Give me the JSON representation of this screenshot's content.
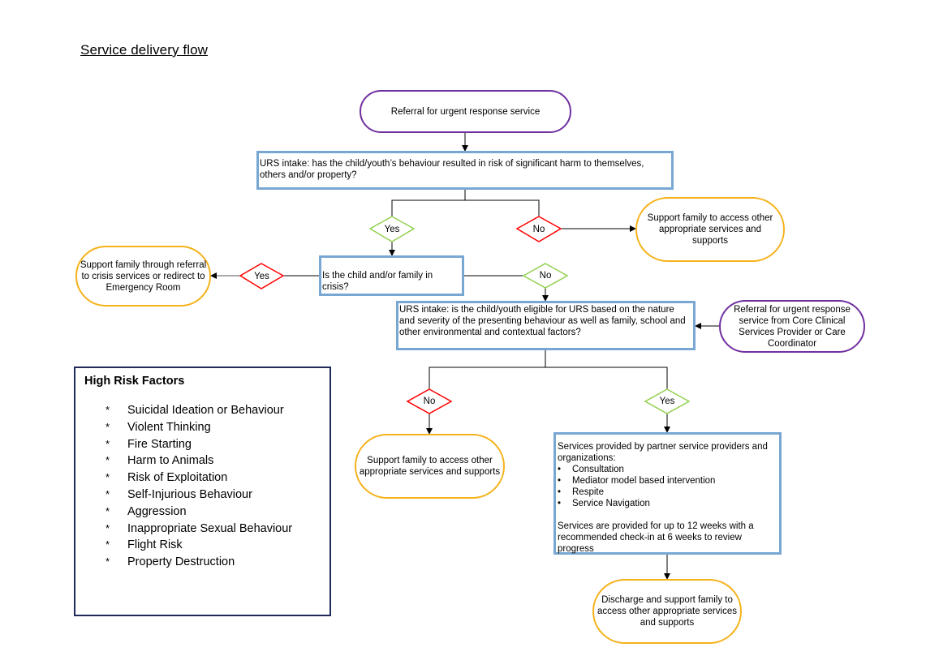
{
  "title": "Service delivery flow",
  "nodes": {
    "referral_start": "Referral for urgent response service",
    "intake_harm": "URS intake: has the child/youth’s behaviour resulted in risk of significant harm to themselves, others and/or property?",
    "support_other_top": "Support family to access other appropriate services and supports",
    "crisis_question": "Is the child and/or family in crisis?",
    "support_crisis": "Support family through referral to crisis services or redirect to Emergency Room",
    "intake_eligible": "URS intake: is the child/youth eligible for URS based on the nature and severity of the presenting behaviour as well as family, school and other environmental and contextual factors?",
    "referral_core": "Referral for urgent response service from Core Clinical Services Provider or Care Coordinator",
    "support_other_bottom": "Support family to access other appropriate services and supports",
    "services": {
      "intro": "Services provided by partner service providers and organizations:",
      "items": [
        "Consultation",
        "Mediator model based intervention",
        "Respite",
        "Service Navigation"
      ],
      "note": "Services are provided for up to 12 weeks with a recommended check-in at 6 weeks to review progress"
    },
    "discharge": "Discharge and support family to access other appropriate services and supports"
  },
  "decisions": {
    "harm_yes": "Yes",
    "harm_no": "No",
    "crisis_yes": "Yes",
    "crisis_no": "No",
    "eligible_no": "No",
    "eligible_yes": "Yes"
  },
  "risk_factors": {
    "title": "High Risk Factors",
    "bullet": "*",
    "items": [
      "Suicidal Ideation or Behaviour",
      "Violent Thinking",
      "Fire Starting",
      "Harm to Animals",
      "Risk of Exploitation",
      "Self-Injurious Behaviour",
      "Aggression",
      "Inappropriate Sexual Behaviour",
      "Flight Risk",
      "Property Destruction"
    ]
  },
  "colors": {
    "start_border": "#7030a0",
    "outcome_border": "#f5b21a",
    "process_border": "#79a7d3",
    "yes_border": "#92d050",
    "no_border": "#ff0000",
    "risk_border": "#1f2a5a"
  }
}
